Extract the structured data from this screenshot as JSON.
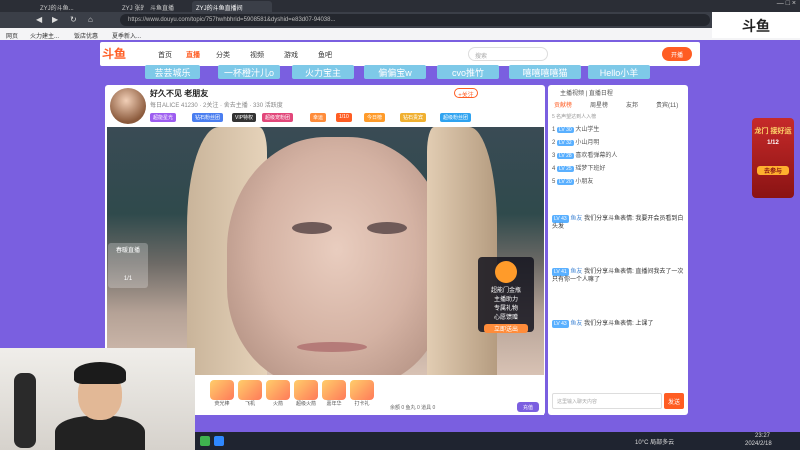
{
  "browser": {
    "tabs": [
      "ZYJ的斗鱼...",
      "ZYJ 张的直播",
      "斗鱼直播",
      "ZYJ的斗鱼直播间"
    ],
    "url": "https://www.douyu.com/topic/757hwhbhrid=5908581&dyshid=e83d07-94038...",
    "bookmarks": [
      "网页",
      "火力建主...",
      "饭店优惠",
      "夏季新入..."
    ],
    "window_controls": "— □ ×"
  },
  "site": {
    "logo": "斗鱼",
    "nav": [
      "首页",
      "直播",
      "分类",
      "视频",
      "游戏",
      "鱼吧"
    ],
    "search_placeholder": "搜索",
    "live_button": "开播",
    "banner": [
      "芸芸城乐",
      "一杯橙汁儿o",
      "火力宝主",
      "偏偏宝w",
      "cvo推竹",
      "嘻嘻嘻嘻猫",
      "Hello小羊"
    ]
  },
  "room": {
    "title": "好久不见 老朋友",
    "meta": "每日ALICE 41230 · 2关注 · 舍去主播 · 330 活跃度",
    "follow": "+关注",
    "tags": [
      "超能星光",
      "钻石粉丝团",
      "VIP特权",
      "超级宠粉团",
      "幸运",
      "1/10",
      "今日榜",
      "钻石贵宾",
      "超级粉丝团"
    ]
  },
  "stream": {
    "promo_label": "春暖直播",
    "promo_count": "1/1",
    "gift_panel_title": "超能门金瓶",
    "gift_panel_lines": [
      "主播助力",
      "专属礼物",
      "心愿馈赠"
    ],
    "gift_panel_button": "立即送出"
  },
  "gifts": {
    "items": [
      "荧光棒",
      "飞机",
      "火箭",
      "超级火箭",
      "嘉年华",
      "打卡礼"
    ],
    "meta": "余额 0   鱼丸 0   道具 0",
    "charge": "充值"
  },
  "sidepanel": {
    "header": "主播视频  |  直播日程",
    "tabs": [
      "贡献榜",
      "周星榜",
      "友邦",
      "贵宾(11)"
    ],
    "subtitle": "5 名声望达到人入榜",
    "ranks": [
      {
        "n": "1",
        "lvl": "LV 30",
        "name": "大山学生"
      },
      {
        "n": "2",
        "lvl": "LV 32",
        "name": "小山月明"
      },
      {
        "n": "3",
        "lvl": "LV 28",
        "name": "喜欢看弹幕的人"
      },
      {
        "n": "4",
        "lvl": "LV 25",
        "name": "瑶梦下班好"
      },
      {
        "n": "5",
        "lvl": "LV 20",
        "name": "小朋友"
      }
    ],
    "messages": [
      {
        "lvl": "LV 43",
        "nick": "鱼友",
        "text": "我们分享斗鱼表情: 我要开会员看到白头发"
      },
      {
        "lvl": "LV 41",
        "nick": "鱼友",
        "text": "我们分享斗鱼表情: 直播间我去了一次 只有你一个人嘛了"
      },
      {
        "lvl": "LV 43",
        "nick": "鱼友",
        "text": "我们分享斗鱼表情: 上课了"
      }
    ],
    "input_placeholder": "这里输入聊天内容",
    "send": "发送"
  },
  "right_promo": {
    "title": "龙门 接好运",
    "count": "1/12",
    "button": "去参与"
  },
  "overlay_logo": "斗鱼",
  "taskbar": {
    "weather": "10°C 局部多云",
    "time": "23:27",
    "date": "2024/2/18"
  }
}
